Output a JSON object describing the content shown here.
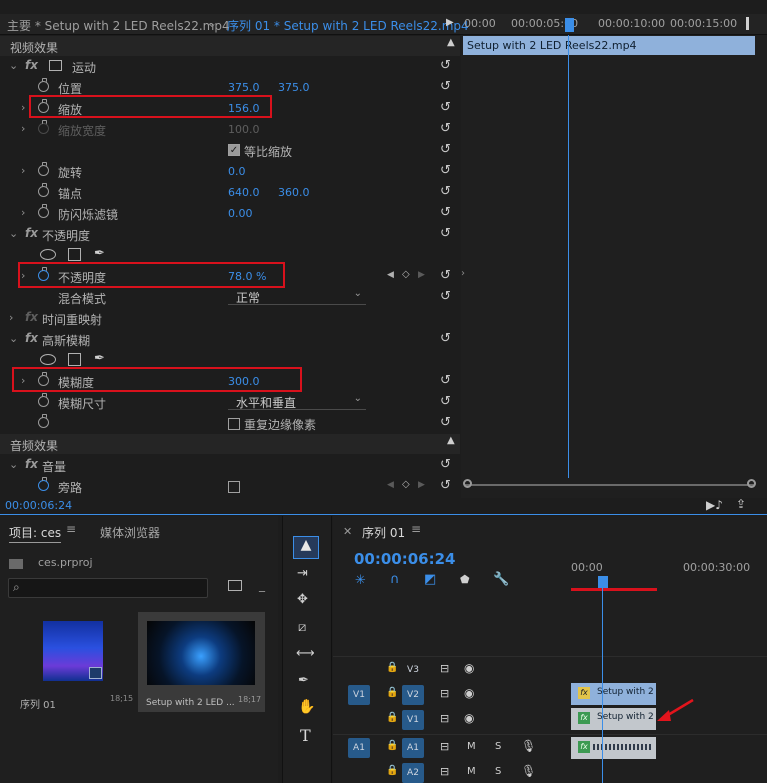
{
  "header": {
    "source_tab": "主要 * Setup with 2 LED Reels22.mp4",
    "sequence_tab": "序列 01 * Setup with 2 LED Reels22.mp4",
    "ruler": [
      "00:00",
      "00:00:05:00",
      "00:00:10:00",
      "00:00:15:00"
    ],
    "clip_name": "Setup with 2 LED Reels22.mp4"
  },
  "effects": {
    "video_section": "视频效果",
    "audio_section": "音频效果",
    "motion": "运动",
    "position": {
      "label": "位置",
      "x": "375.0",
      "y": "375.0"
    },
    "scale": {
      "label": "缩放",
      "value": "156.0"
    },
    "scale_width": {
      "label": "缩放宽度",
      "value": "100.0"
    },
    "uniform_scale": "等比缩放",
    "rotation": {
      "label": "旋转",
      "value": "0.0"
    },
    "anchor": {
      "label": "锚点",
      "x": "640.0",
      "y": "360.0"
    },
    "anti_flicker": {
      "label": "防闪烁滤镜",
      "value": "0.00"
    },
    "opacity_group": "不透明度",
    "opacity": {
      "label": "不透明度",
      "value": "78.0 %"
    },
    "blend": {
      "label": "混合模式",
      "value": "正常"
    },
    "time_remap": "时间重映射",
    "gaussian": "高斯模糊",
    "blurriness": {
      "label": "模糊度",
      "value": "300.0"
    },
    "blur_dim": {
      "label": "模糊尺寸",
      "value": "水平和垂直"
    },
    "repeat_edge": "重复边缘像素",
    "volume": "音量",
    "bypass": "旁路",
    "timecode": "00:00:06:24"
  },
  "project": {
    "tab": "项目: ces",
    "media_tab": "媒体浏览器",
    "file": "ces.prproj",
    "search_placeholder": "",
    "items": [
      {
        "name": "序列 01",
        "dur": "18;15"
      },
      {
        "name": "Setup with 2 LED ...",
        "dur": "18;17"
      }
    ]
  },
  "timeline": {
    "tab": "序列 01",
    "timecode": "00:00:06:24",
    "ruler": [
      "00:00",
      "00:00:30:00"
    ],
    "tracks": {
      "v3": "V3",
      "v2": "V2",
      "v1": "V1",
      "a1": "A1",
      "a2": "A2",
      "src_v": "V1",
      "src_a": "A1",
      "m": "M",
      "s": "S"
    },
    "clip_v2": "Setup with 2 LED",
    "clip_v1": "Setup with 2 LED",
    "fx_badge": "fx"
  },
  "colors": {
    "accent": "#3b8ee8",
    "highlight": "#d8111c",
    "clip": "#8fb1db"
  }
}
